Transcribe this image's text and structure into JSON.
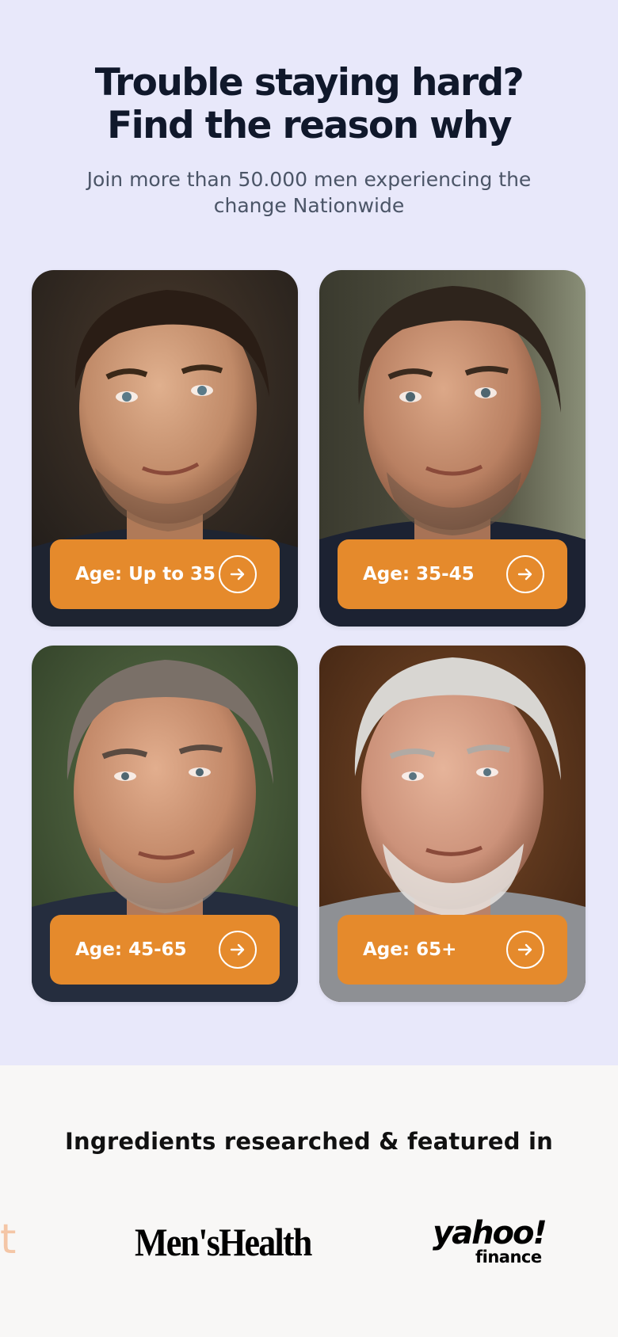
{
  "hero": {
    "headline_line1": "Trouble staying hard?",
    "headline_line2": "Find the reason why",
    "subline": "Join more than 50.000 men experiencing the change Nationwide"
  },
  "age_cards": [
    {
      "label": "Age: Up to 35",
      "icon": "arrow-right-circle-icon"
    },
    {
      "label": "Age: 35-45",
      "icon": "arrow-right-circle-icon"
    },
    {
      "label": "Age: 45-65",
      "icon": "arrow-right-circle-icon"
    },
    {
      "label": "Age: 65+",
      "icon": "arrow-right-circle-icon"
    }
  ],
  "press": {
    "title": "Ingredients researched & featured in",
    "partial_logo_text": "t",
    "logos": [
      {
        "name": "mens-health-logo",
        "text": "Men'sHealth"
      },
      {
        "name": "yahoo-finance-logo",
        "text": "yahoo!",
        "subtext": "finance"
      }
    ]
  },
  "colors": {
    "hero_background": "#e8e8fa",
    "button_orange": "#e58a2c",
    "headline": "#10182b",
    "press_background": "#f8f7f6"
  }
}
